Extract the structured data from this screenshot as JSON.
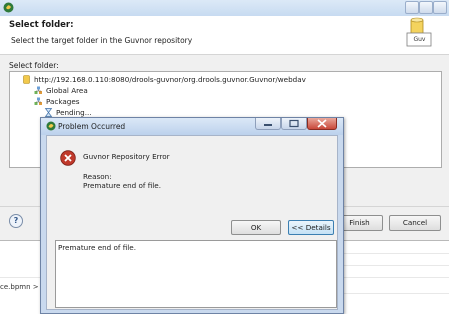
{
  "wizard": {
    "header_title": "Select folder:",
    "header_description": "Select the target folder in the Guvnor repository",
    "banner_icon_text": "Guv",
    "select_folder_label": "Select folder:",
    "tree": [
      {
        "label": "http://192.168.0.110:8080/drools-guvnor/org.drools.guvnor.Guvnor/webdav",
        "icon": "repository-icon"
      },
      {
        "label": "Global Area",
        "icon": "package-icon"
      },
      {
        "label": "Packages",
        "icon": "package-icon"
      },
      {
        "label": "Pending...",
        "icon": "hourglass-icon"
      }
    ],
    "help_label": "?",
    "finish_label": "Finish",
    "cancel_label": "Cancel"
  },
  "editor": {
    "tab_label": "ce.bpmn >"
  },
  "problem_dialog": {
    "title": "Problem Occurred",
    "error_title": "Guvnor Repository Error",
    "reason_label": "Reason:",
    "reason_text": "Premature end of file.",
    "ok_label": "OK",
    "details_label": "<< Details",
    "details_text": "Premature end of file."
  },
  "colors": {
    "title_bar": "#c7dbf1",
    "dialog_frame": "#c9d9ee",
    "error_red": "#c0392b",
    "dialog_background": "#f0f0f0"
  }
}
